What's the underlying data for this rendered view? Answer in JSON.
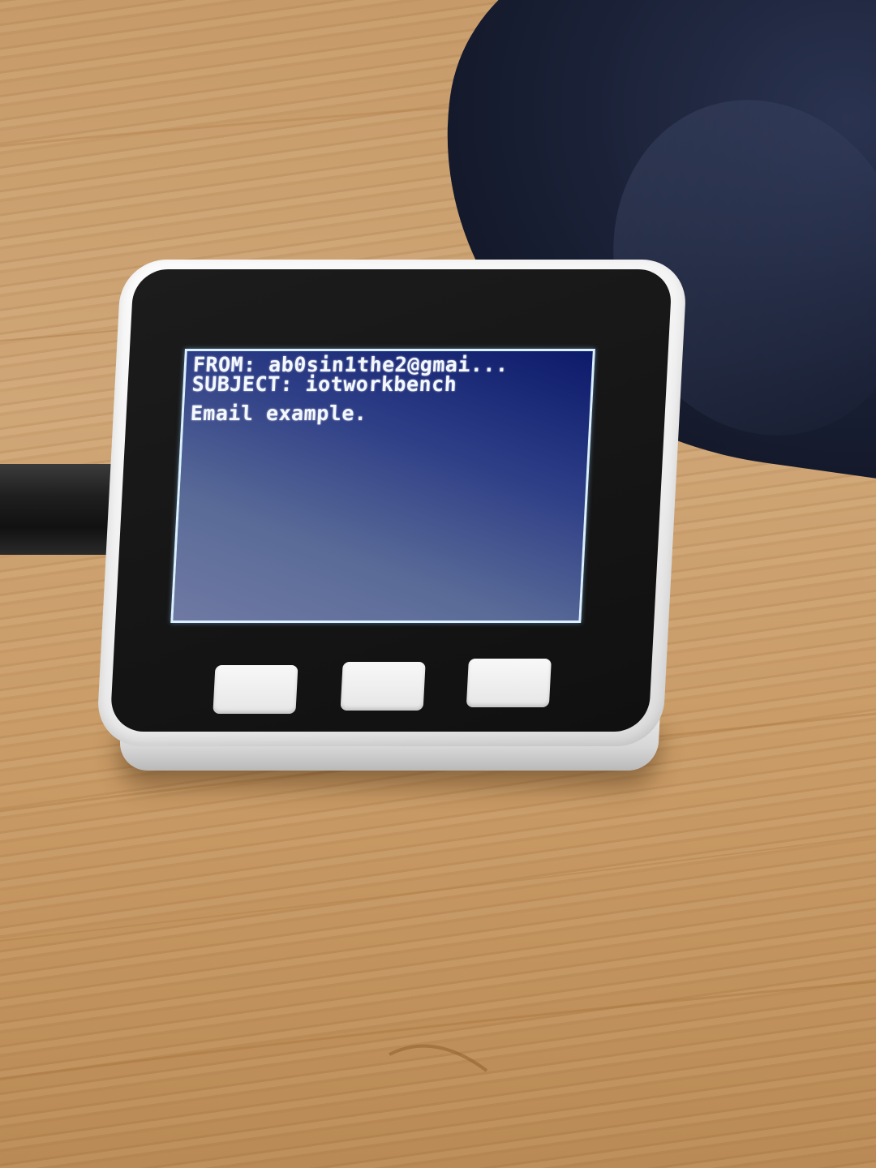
{
  "screen": {
    "from_line": "FROM: ab0sin1the2@gmai...",
    "subject_line": "SUBJECT: iotworkbench",
    "body_line": "Email example."
  },
  "colors": {
    "screen_background": "#2d3d86",
    "screen_text": "#f4f8ff",
    "screen_border": "#d8f0ff",
    "device_shell": "#f2f2f2",
    "device_face": "#141414",
    "table_wood": "#c99b66",
    "fabric": "#1b2238",
    "cable": "#1f1f1f"
  },
  "icons": {
    "button_a": "physical-button-a",
    "button_b": "physical-button-b",
    "button_c": "physical-button-c"
  }
}
